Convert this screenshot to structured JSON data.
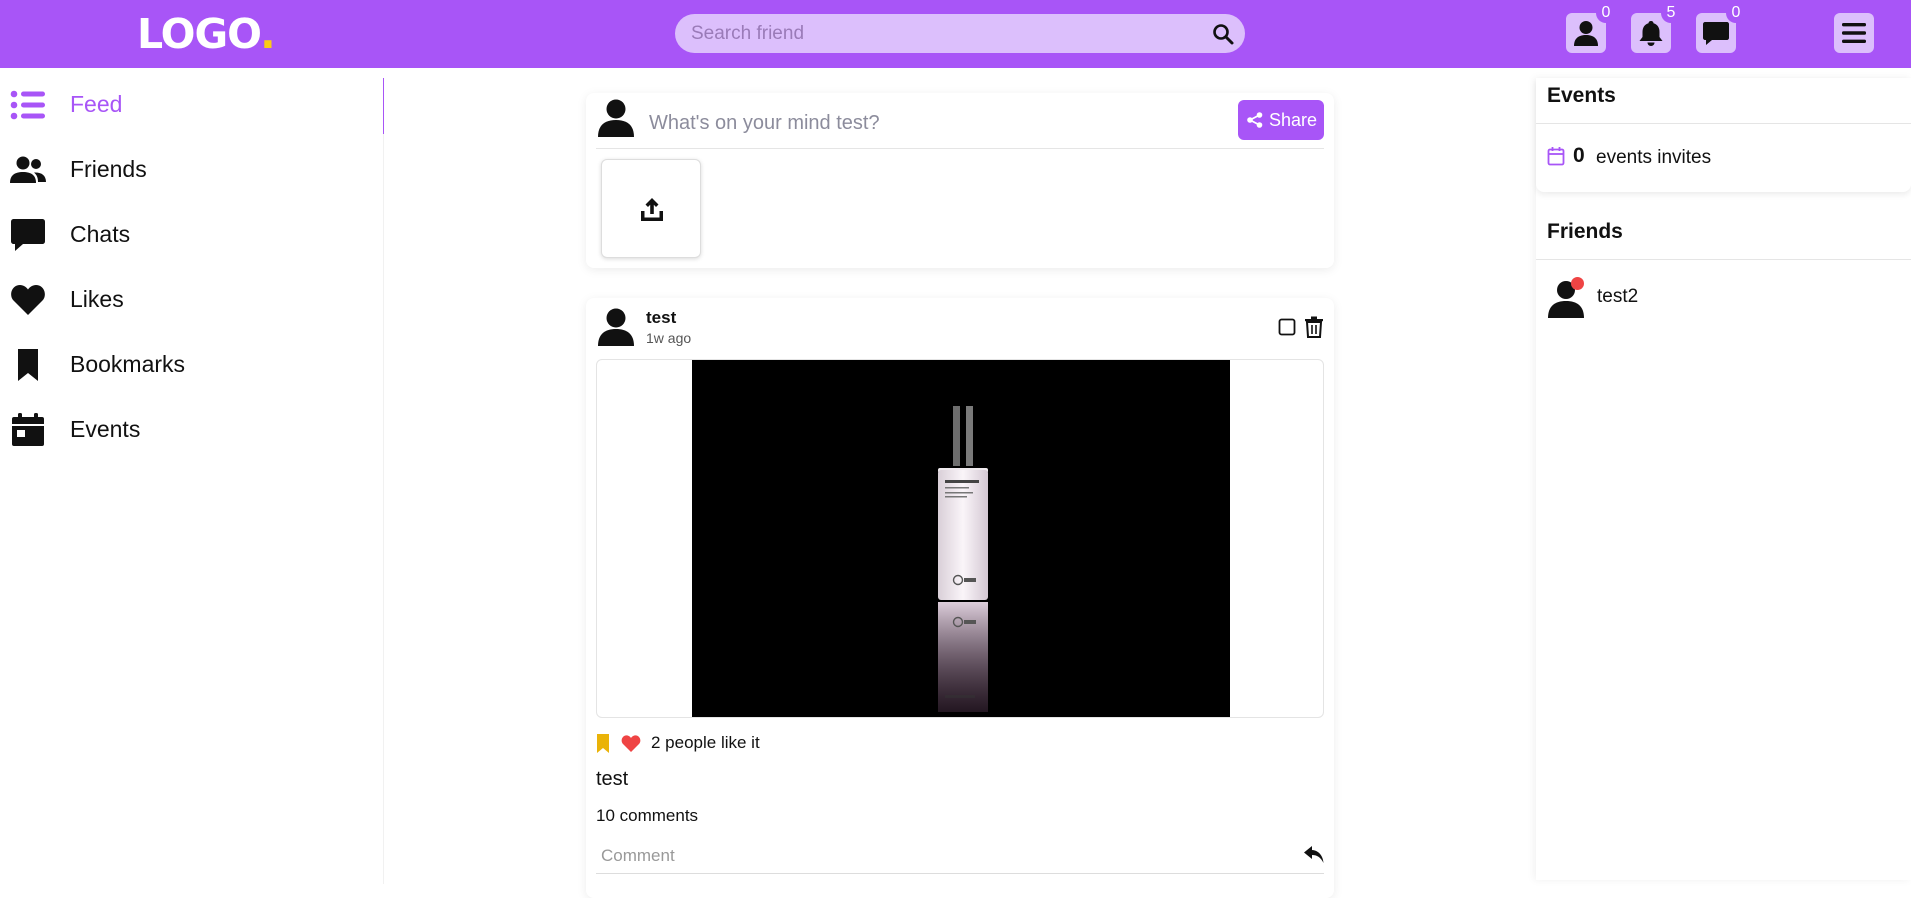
{
  "header": {
    "logo_text": "LOGO",
    "logo_dot": ".",
    "search_placeholder": "Search friend",
    "friend_requests_count": "0",
    "notifications_count": "5",
    "messages_count": "0"
  },
  "sidebar": {
    "items": [
      {
        "label": "Feed",
        "icon": "list-icon",
        "active": true
      },
      {
        "label": "Friends",
        "icon": "users-icon"
      },
      {
        "label": "Chats",
        "icon": "chat-bubble-icon"
      },
      {
        "label": "Likes",
        "icon": "heart-icon"
      },
      {
        "label": "Bookmarks",
        "icon": "bookmark-icon"
      },
      {
        "label": "Events",
        "icon": "calendar-icon"
      }
    ]
  },
  "composer": {
    "placeholder": "What's on your mind test?",
    "share_label": "Share"
  },
  "post": {
    "author": "test",
    "time": "1w ago",
    "likes_text": "2 people like it",
    "caption": "test",
    "comments_count": "10 comments",
    "comment_placeholder": "Comment"
  },
  "events": {
    "title": "Events",
    "count": "0",
    "label": "events invites"
  },
  "friends": {
    "title": "Friends",
    "list": [
      {
        "name": "test2",
        "online_status_color": "#ef4444"
      }
    ]
  },
  "colors": {
    "accent": "#a855f7",
    "logo_dot": "#facc15",
    "like": "#ef4444",
    "bookmark": "#eab308"
  }
}
